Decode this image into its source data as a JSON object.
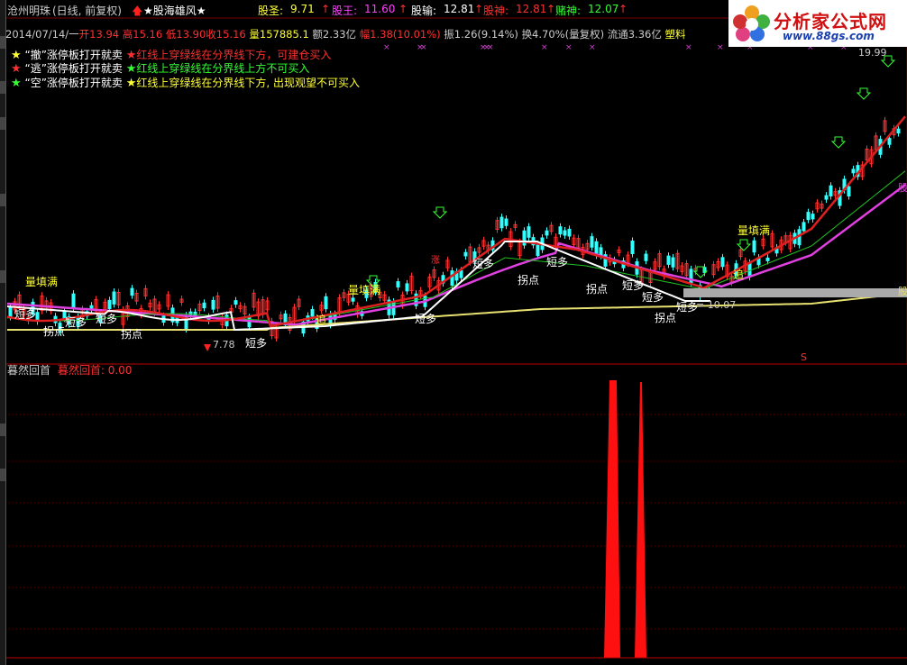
{
  "header": {
    "stock_name": "沧州明珠",
    "period_label": "(日线, 前复权)",
    "formula_name": "★股海雄风★",
    "gusheng_label": "股圣:",
    "gusheng_value": "9.71",
    "guwang_label": "股王:",
    "guwang_value": "11.60",
    "gushu_label": "股输:",
    "gushu_value": "12.81",
    "gushen_label": "股神:",
    "gushen_value": "12.81",
    "dushen_label": "赌神:",
    "dushen_value": "12.07",
    "arrow_up": "↑"
  },
  "info": {
    "date": "2014/07/14/一",
    "open_label": "开",
    "open": "13.94",
    "high_label": "高",
    "high": "15.16",
    "low_label": "低",
    "low": "13.90",
    "close_label": "收",
    "close": "15.16",
    "volume": "量157885.1",
    "amount": "额2.33亿",
    "change": "幅1.38(10.01%)",
    "amplitude": "振1.26(9.14%)",
    "turnover": "换4.70%(量复权)",
    "float": "流通3.36亿",
    "sector": "塑料"
  },
  "legend": [
    {
      "star": "★",
      "text1": "“撤”涨停板打开就卖",
      "star2": "★",
      "text2": "红线上穿绿线在分界线下方，可建仓买入",
      "c1": "#ffff33",
      "c2": "#ff3030"
    },
    {
      "star": "★",
      "text1": "“逃”涨停板打开就卖",
      "star2": "★",
      "text2": "红线上穿绿线在分界线上方不可买入",
      "c1": "#ff3030",
      "c2": "#33ff33"
    },
    {
      "star": "★",
      "text1": "“空”涨停板打开就卖",
      "star2": "★",
      "text2": "红线上穿绿线在分界线下方, 出现观望不可买入",
      "c1": "#33ff33",
      "c2": "#ffff33"
    }
  ],
  "annotations": {
    "liangtianman": "量填满",
    "duanduo": "短多",
    "guaidian": "拐点",
    "zhui": "追",
    "price_hi": "19.99",
    "price_lo": "7.78",
    "price_mid": "= 10.07",
    "zhang": "涨",
    "right_tag": "股",
    "s_mark": "S"
  },
  "logo": {
    "title": "分析家公式网",
    "url": "www.88gs.com"
  },
  "sub_panel": {
    "name": "暮然回首",
    "label": "暮然回首:",
    "value": "0.00"
  },
  "colors": {
    "up": "#ff3030",
    "down": "#33ffff",
    "red_line": "#e02020",
    "green_line": "#20c020",
    "magenta_line": "#e040e0",
    "white_line": "#ffffff",
    "yellow_line": "#e8e070",
    "grid": "#7a0000"
  }
}
